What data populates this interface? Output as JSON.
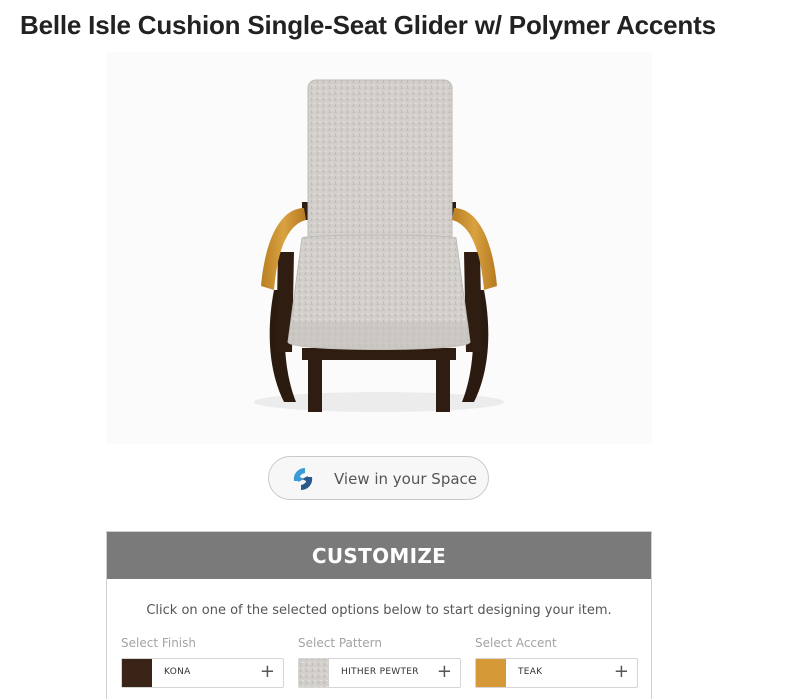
{
  "product": {
    "title": "Belle Isle Cushion Single-Seat Glider w/ Polymer Accents"
  },
  "ar_button": {
    "label": "View in your Space",
    "icon": "ar-view-icon"
  },
  "customize": {
    "header": "CUSTOMIZE",
    "instructions": "Click on one of the selected options below to start designing your item.",
    "options": [
      {
        "label": "Select Finish",
        "value": "KONA",
        "swatch_color": "#3a2418",
        "icon": "plus-icon",
        "plus": "+"
      },
      {
        "label": "Select Pattern",
        "value": "HITHER PEWTER",
        "swatch_color": "#c4c1bd",
        "icon": "plus-icon",
        "plus": "+"
      },
      {
        "label": "Select Accent",
        "value": "TEAK",
        "swatch_color": "#d59a37",
        "icon": "plus-icon",
        "plus": "+"
      }
    ]
  },
  "colors": {
    "header_bg": "#7a7a7a",
    "frame": "#2f1d12",
    "arm_wood": "#c9902e",
    "cushion": "#d3d0cc"
  }
}
